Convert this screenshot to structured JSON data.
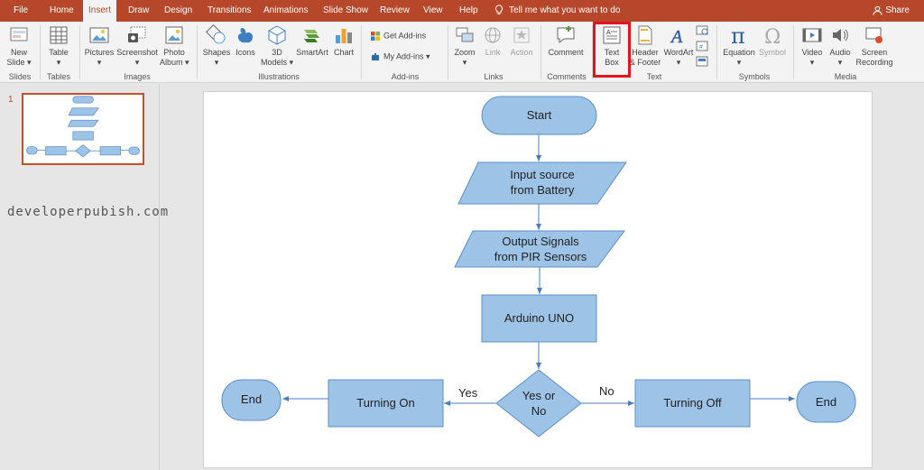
{
  "tabs": [
    "File",
    "Home",
    "Insert",
    "Draw",
    "Design",
    "Transitions",
    "Animations",
    "Slide Show",
    "Review",
    "View",
    "Help"
  ],
  "active_tab": "Insert",
  "tell_me": "Tell me what you want to do",
  "share": "Share",
  "ribbon": {
    "new_slide": [
      "New",
      "Slide"
    ],
    "table": "Table",
    "pictures": "Pictures",
    "screenshot": "Screenshot",
    "photo_album": [
      "Photo",
      "Album"
    ],
    "shapes": "Shapes",
    "icons": "Icons",
    "models_3d": [
      "3D",
      "Models"
    ],
    "smartart": "SmartArt",
    "chart": "Chart",
    "get_addins": "Get Add-ins",
    "my_addins": "My Add-ins",
    "zoom": "Zoom",
    "link": "Link",
    "action": "Action",
    "comment": "Comment",
    "text_box": [
      "Text",
      "Box"
    ],
    "header_footer": [
      "Header",
      "& Footer"
    ],
    "wordart": "WordArt",
    "equation": "Equation",
    "symbol": "Symbol",
    "video": "Video",
    "audio": "Audio",
    "screen_recording": [
      "Screen",
      "Recording"
    ],
    "groups": {
      "slides": "Slides",
      "tables": "Tables",
      "images": "Images",
      "illustrations": "Illustrations",
      "addins": "Add-ins",
      "links": "Links",
      "comments": "Comments",
      "text": "Text",
      "symbols": "Symbols",
      "media": "Media"
    }
  },
  "slide_number": "1",
  "watermark": "developerpubish.com",
  "flowchart": {
    "start": "Start",
    "input": [
      "Input source",
      "from Battery"
    ],
    "output": [
      "Output Signals",
      "from PIR Sensors"
    ],
    "arduino": "Arduino UNO",
    "decision": [
      "Yes or",
      "No"
    ],
    "turning_on": "Turning On",
    "turning_off": "Turning Off",
    "end_left": "End",
    "end_right": "End",
    "yes_label": "Yes",
    "no_label": "No"
  },
  "colors": {
    "accent": "#b7472a",
    "shape_fill": "#9dc3e6",
    "shape_stroke": "#5b8fc9",
    "arrow": "#4a7ebb",
    "highlight": "#e3141d"
  }
}
